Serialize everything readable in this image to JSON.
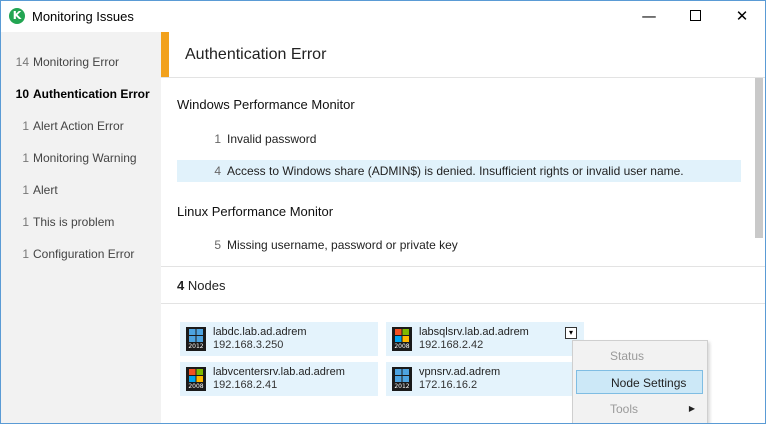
{
  "window": {
    "title": "Monitoring Issues",
    "app_icon_letter": "K",
    "icons": {
      "app": "app-logo-icon",
      "minimize": "minimize-icon",
      "maximize": "maximize-icon",
      "close": "close-icon"
    },
    "controls": {
      "minimize": "—",
      "close": "✕"
    }
  },
  "sidebar": {
    "items": [
      {
        "count": "14",
        "label": "Monitoring Error"
      },
      {
        "count": "10",
        "label": "Authentication Error",
        "active": true
      },
      {
        "count": "1",
        "label": "Alert Action Error"
      },
      {
        "count": "1",
        "label": "Monitoring Warning"
      },
      {
        "count": "1",
        "label": "Alert"
      },
      {
        "count": "1",
        "label": "This is problem"
      },
      {
        "count": "1",
        "label": "Configuration Error"
      }
    ]
  },
  "colors": {
    "accent": "#f2a11c",
    "selection": "#e1f2fb",
    "node_card": "#e4f3fc",
    "app_icon": "#22a552"
  },
  "main": {
    "header_title": "Authentication Error",
    "sections": [
      {
        "title": "Windows Performance Monitor",
        "issues": [
          {
            "count": "1",
            "text": "Invalid password"
          },
          {
            "count": "4",
            "text": "Access to Windows share (ADMIN$) is denied. Insufficient rights or invalid user name.",
            "selected": true
          }
        ]
      },
      {
        "title": "Linux Performance Monitor",
        "issues": [
          {
            "count": "5",
            "text": "Missing username, password or private key"
          }
        ]
      }
    ],
    "nodes": {
      "count": "4",
      "label": "Nodes",
      "items": [
        {
          "name": "labdc.lab.ad.adrem",
          "ip": "192.168.3.250",
          "os_year": "2012",
          "icon": "windows-server-2012-icon"
        },
        {
          "name": "labsqlsrv.lab.ad.adrem",
          "ip": "192.168.2.42",
          "os_year": "2008",
          "icon": "windows-server-2008-icon"
        },
        {
          "name": "labvcentersrv.lab.ad.adrem",
          "ip": "192.168.2.41",
          "os_year": "2008",
          "icon": "windows-server-2008-icon"
        },
        {
          "name": "vpnsrv.ad.adrem",
          "ip": "172.16.16.2",
          "os_year": "2012",
          "icon": "windows-server-2012-icon"
        }
      ]
    }
  },
  "context_menu": {
    "items": [
      {
        "label": "Status",
        "disabled": true
      },
      {
        "label": "Node Settings",
        "highlighted": true
      },
      {
        "label": "Tools",
        "disabled": true,
        "submenu_arrow": "▶"
      }
    ]
  }
}
